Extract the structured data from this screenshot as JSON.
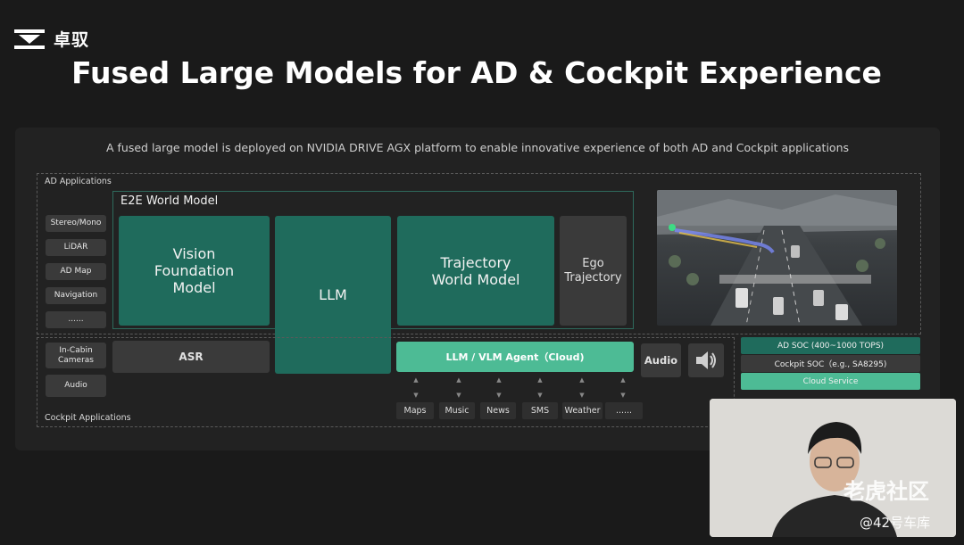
{
  "brand": {
    "name": "卓驭"
  },
  "slide": {
    "title": "Fused Large Models for AD & Cockpit Experience",
    "subtitle": "A fused large model is deployed on NVIDIA DRIVE AGX platform to enable innovative experience of both AD and Cockpit applications"
  },
  "ad_section": {
    "label": "AD Applications",
    "inputs": [
      "Stereo/Mono",
      "LiDAR",
      "AD Map",
      "Navigation",
      "......"
    ]
  },
  "e2e": {
    "label": "E2E World Model",
    "vision_foundation_model": "Vision Foundation Model",
    "llm": "LLM",
    "trajectory_world_model": "Trajectory World Model",
    "ego_trajectory": "Ego Trajectory"
  },
  "cockpit_section": {
    "label": "Cockpit Applications",
    "inputs": [
      "In-Cabin Cameras",
      "Audio"
    ],
    "asr": "ASR",
    "agent": "LLM / VLM Agent（Cloud)",
    "audio_label": "Audio",
    "apps": [
      "Maps",
      "Music",
      "News",
      "SMS",
      "Weather",
      "......"
    ]
  },
  "hardware": {
    "items": [
      {
        "label": "AD SOC (400~1000 TOPS)",
        "color": "#1f6b5c"
      },
      {
        "label": "Cockpit SOC（e.g., SA8295)",
        "color": "#3a3a3a"
      },
      {
        "label": "Cloud Service",
        "color": "#4dbb95"
      }
    ]
  },
  "video_overlay": {
    "watermark": "老虎社区",
    "handle": "@42号车库"
  },
  "colors": {
    "background": "#1a1a1a",
    "panel": "#222222",
    "green_dark": "#1f6b5c",
    "green_light": "#4dbb95",
    "gray_box": "#3a3a3a"
  }
}
